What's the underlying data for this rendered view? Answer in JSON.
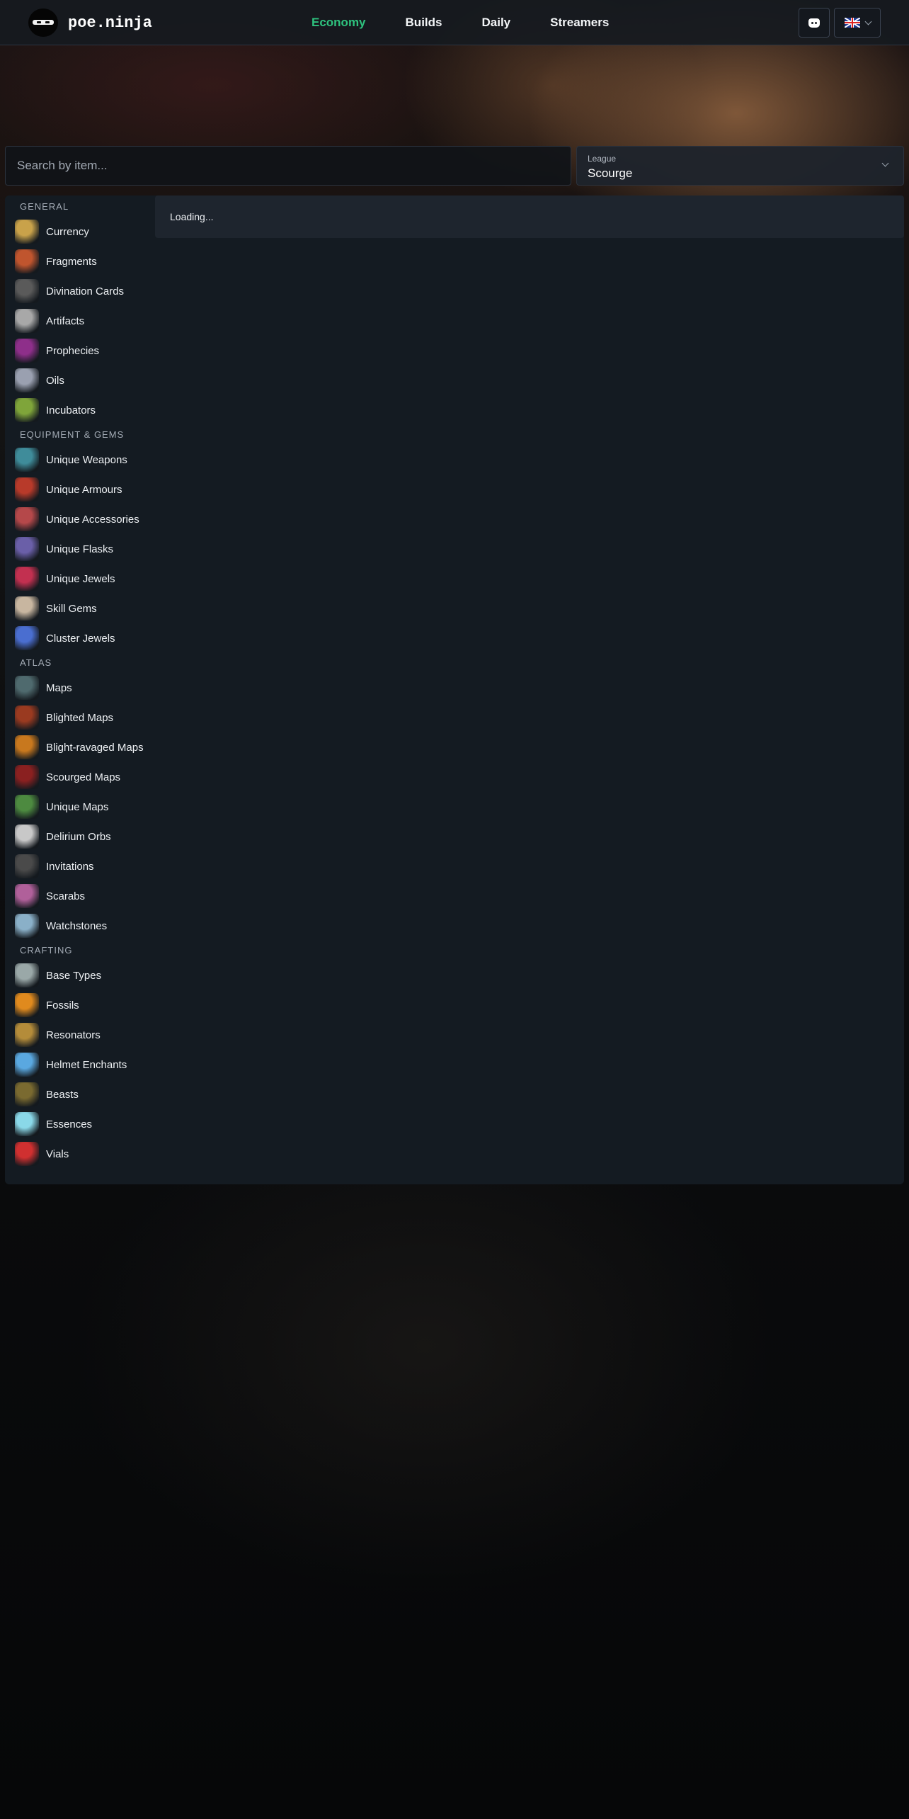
{
  "header": {
    "brand": "poe.ninja",
    "nav": [
      {
        "label": "Economy",
        "active": true
      },
      {
        "label": "Builds",
        "active": false
      },
      {
        "label": "Daily",
        "active": false
      },
      {
        "label": "Streamers",
        "active": false
      }
    ],
    "discord_icon": "discord-icon",
    "language_icon": "uk-flag-icon"
  },
  "search": {
    "placeholder": "Search by item..."
  },
  "league": {
    "label": "League",
    "value": "Scourge"
  },
  "content": {
    "status": "Loading..."
  },
  "accent_color": "#2ec27e",
  "sidebar": {
    "sections": [
      {
        "title": "General",
        "items": [
          {
            "label": "Currency",
            "color": "#c9a24a"
          },
          {
            "label": "Fragments",
            "color": "#c0552e"
          },
          {
            "label": "Divination Cards",
            "color": "#5a5a5a"
          },
          {
            "label": "Artifacts",
            "color": "#a8a8a8"
          },
          {
            "label": "Prophecies",
            "color": "#8e2f8a"
          },
          {
            "label": "Oils",
            "color": "#9aa0b0"
          },
          {
            "label": "Incubators",
            "color": "#7fa53a"
          }
        ]
      },
      {
        "title": "Equipment & Gems",
        "items": [
          {
            "label": "Unique Weapons",
            "color": "#3f8c9a"
          },
          {
            "label": "Unique Armours",
            "color": "#b83a2a"
          },
          {
            "label": "Unique Accessories",
            "color": "#b5484a"
          },
          {
            "label": "Unique Flasks",
            "color": "#6a5fa8"
          },
          {
            "label": "Unique Jewels",
            "color": "#c23050"
          },
          {
            "label": "Skill Gems",
            "color": "#c8b6a0"
          },
          {
            "label": "Cluster Jewels",
            "color": "#4a6ed0"
          }
        ]
      },
      {
        "title": "Atlas",
        "items": [
          {
            "label": "Maps",
            "color": "#4f6a6e"
          },
          {
            "label": "Blighted Maps",
            "color": "#9a3a20"
          },
          {
            "label": "Blight-ravaged Maps",
            "color": "#c8781e"
          },
          {
            "label": "Scourged Maps",
            "color": "#8a2020"
          },
          {
            "label": "Unique Maps",
            "color": "#4d8a40"
          },
          {
            "label": "Delirium Orbs",
            "color": "#c8c8c8"
          },
          {
            "label": "Invitations",
            "color": "#4a4a4a"
          },
          {
            "label": "Scarabs",
            "color": "#b0609a"
          },
          {
            "label": "Watchstones",
            "color": "#8ab0c8"
          }
        ]
      },
      {
        "title": "Crafting",
        "items": [
          {
            "label": "Base Types",
            "color": "#9aa8a8"
          },
          {
            "label": "Fossils",
            "color": "#e08a1e"
          },
          {
            "label": "Resonators",
            "color": "#b48c3a"
          },
          {
            "label": "Helmet Enchants",
            "color": "#5aa8e0"
          },
          {
            "label": "Beasts",
            "color": "#7a6a30"
          },
          {
            "label": "Essences",
            "color": "#8ad8e8"
          },
          {
            "label": "Vials",
            "color": "#d03030"
          }
        ]
      }
    ]
  }
}
